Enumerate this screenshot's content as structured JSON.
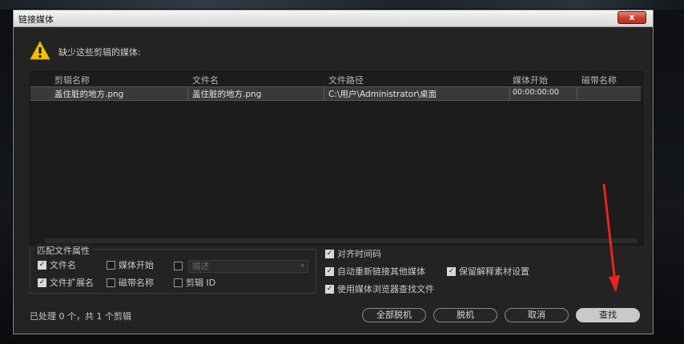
{
  "window": {
    "title": "链接媒体",
    "close_label": "x"
  },
  "message": "缺少这些剪辑的媒体:",
  "table": {
    "columns": [
      "剪辑名称",
      "文件名",
      "文件路径",
      "媒体开始",
      "磁带名称"
    ],
    "rows": [
      {
        "clip_name": "盖住脏的地方.png",
        "file_name": "盖住脏的地方.png",
        "path": "C:\\用户\\Administrator\\桌面",
        "media_start": "00:00:00:00",
        "tape_name": ""
      }
    ]
  },
  "match": {
    "legend": "匹配文件属性",
    "options": {
      "filename": {
        "label": "文件名",
        "checked": true
      },
      "media_start": {
        "label": "媒体开始",
        "checked": false
      },
      "description": {
        "label": "",
        "checked": false
      },
      "extension": {
        "label": "文件扩展名",
        "checked": true
      },
      "tape_name": {
        "label": "磁带名称",
        "checked": false
      },
      "clip_id": {
        "label": "剪辑 ID",
        "checked": false
      }
    },
    "description_select": {
      "value": "描述"
    }
  },
  "options": {
    "align_timecode": {
      "label": "对齐时间码",
      "checked": true
    },
    "auto_relink": {
      "label": "自动重新链接其他媒体",
      "checked": true
    },
    "preserve_interpret": {
      "label": "保留解释素材设置",
      "checked": true
    },
    "use_browser": {
      "label": "使用媒体浏览器查找文件",
      "checked": true
    }
  },
  "status": "已处理 0 个，共 1 个剪辑",
  "buttons": {
    "offline_all": "全部脱机",
    "offline": "脱机",
    "cancel": "取消",
    "locate": "查找"
  },
  "colors": {
    "dialog_bg": "#232323",
    "row_bg": "#3a3a3a",
    "warning": "#f2c200",
    "annotation_arrow": "#e8261c"
  }
}
